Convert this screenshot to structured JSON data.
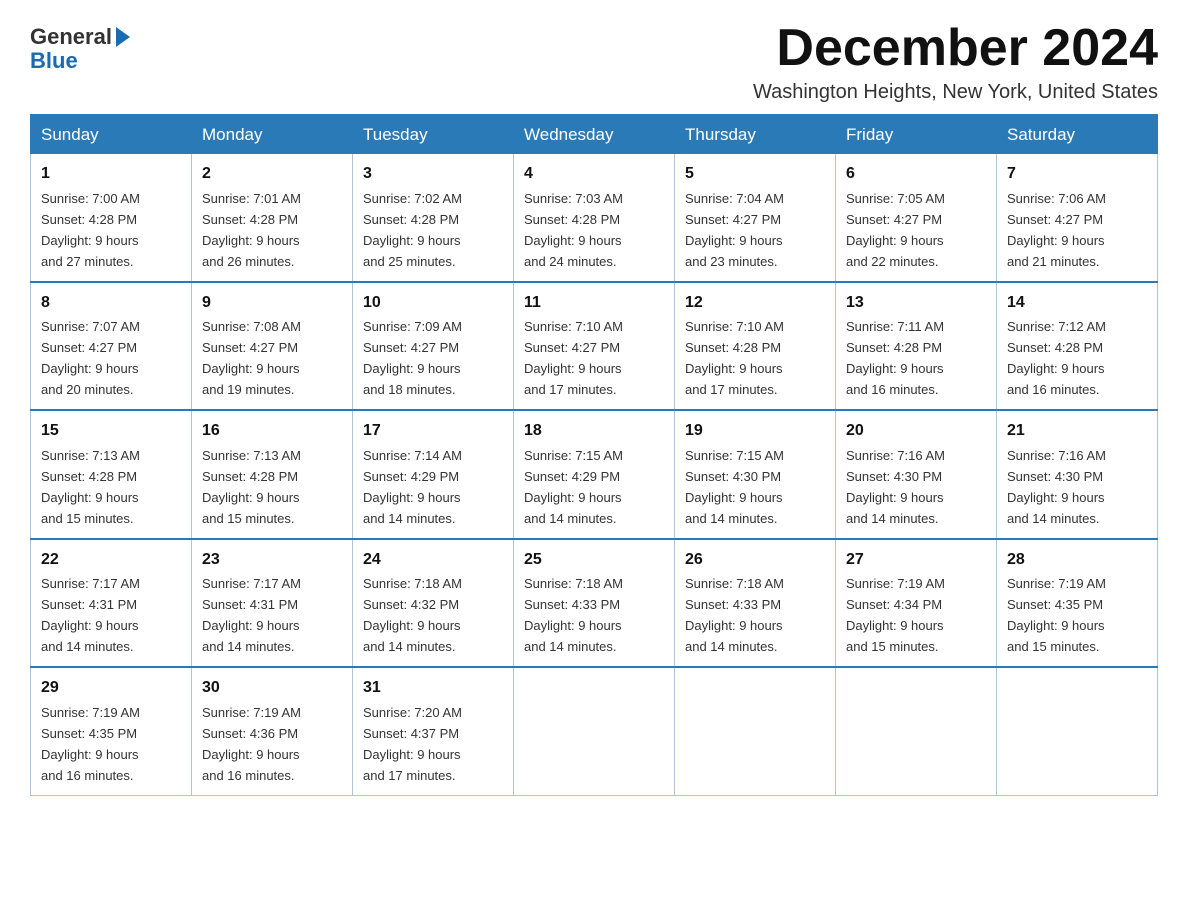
{
  "header": {
    "logo_general": "General",
    "logo_blue": "Blue",
    "month_title": "December 2024",
    "subtitle": "Washington Heights, New York, United States"
  },
  "days_of_week": [
    "Sunday",
    "Monday",
    "Tuesday",
    "Wednesday",
    "Thursday",
    "Friday",
    "Saturday"
  ],
  "weeks": [
    [
      {
        "day": "1",
        "sunrise": "7:00 AM",
        "sunset": "4:28 PM",
        "daylight": "9 hours and 27 minutes."
      },
      {
        "day": "2",
        "sunrise": "7:01 AM",
        "sunset": "4:28 PM",
        "daylight": "9 hours and 26 minutes."
      },
      {
        "day": "3",
        "sunrise": "7:02 AM",
        "sunset": "4:28 PM",
        "daylight": "9 hours and 25 minutes."
      },
      {
        "day": "4",
        "sunrise": "7:03 AM",
        "sunset": "4:28 PM",
        "daylight": "9 hours and 24 minutes."
      },
      {
        "day": "5",
        "sunrise": "7:04 AM",
        "sunset": "4:27 PM",
        "daylight": "9 hours and 23 minutes."
      },
      {
        "day": "6",
        "sunrise": "7:05 AM",
        "sunset": "4:27 PM",
        "daylight": "9 hours and 22 minutes."
      },
      {
        "day": "7",
        "sunrise": "7:06 AM",
        "sunset": "4:27 PM",
        "daylight": "9 hours and 21 minutes."
      }
    ],
    [
      {
        "day": "8",
        "sunrise": "7:07 AM",
        "sunset": "4:27 PM",
        "daylight": "9 hours and 20 minutes."
      },
      {
        "day": "9",
        "sunrise": "7:08 AM",
        "sunset": "4:27 PM",
        "daylight": "9 hours and 19 minutes."
      },
      {
        "day": "10",
        "sunrise": "7:09 AM",
        "sunset": "4:27 PM",
        "daylight": "9 hours and 18 minutes."
      },
      {
        "day": "11",
        "sunrise": "7:10 AM",
        "sunset": "4:27 PM",
        "daylight": "9 hours and 17 minutes."
      },
      {
        "day": "12",
        "sunrise": "7:10 AM",
        "sunset": "4:28 PM",
        "daylight": "9 hours and 17 minutes."
      },
      {
        "day": "13",
        "sunrise": "7:11 AM",
        "sunset": "4:28 PM",
        "daylight": "9 hours and 16 minutes."
      },
      {
        "day": "14",
        "sunrise": "7:12 AM",
        "sunset": "4:28 PM",
        "daylight": "9 hours and 16 minutes."
      }
    ],
    [
      {
        "day": "15",
        "sunrise": "7:13 AM",
        "sunset": "4:28 PM",
        "daylight": "9 hours and 15 minutes."
      },
      {
        "day": "16",
        "sunrise": "7:13 AM",
        "sunset": "4:28 PM",
        "daylight": "9 hours and 15 minutes."
      },
      {
        "day": "17",
        "sunrise": "7:14 AM",
        "sunset": "4:29 PM",
        "daylight": "9 hours and 14 minutes."
      },
      {
        "day": "18",
        "sunrise": "7:15 AM",
        "sunset": "4:29 PM",
        "daylight": "9 hours and 14 minutes."
      },
      {
        "day": "19",
        "sunrise": "7:15 AM",
        "sunset": "4:30 PM",
        "daylight": "9 hours and 14 minutes."
      },
      {
        "day": "20",
        "sunrise": "7:16 AM",
        "sunset": "4:30 PM",
        "daylight": "9 hours and 14 minutes."
      },
      {
        "day": "21",
        "sunrise": "7:16 AM",
        "sunset": "4:30 PM",
        "daylight": "9 hours and 14 minutes."
      }
    ],
    [
      {
        "day": "22",
        "sunrise": "7:17 AM",
        "sunset": "4:31 PM",
        "daylight": "9 hours and 14 minutes."
      },
      {
        "day": "23",
        "sunrise": "7:17 AM",
        "sunset": "4:31 PM",
        "daylight": "9 hours and 14 minutes."
      },
      {
        "day": "24",
        "sunrise": "7:18 AM",
        "sunset": "4:32 PM",
        "daylight": "9 hours and 14 minutes."
      },
      {
        "day": "25",
        "sunrise": "7:18 AM",
        "sunset": "4:33 PM",
        "daylight": "9 hours and 14 minutes."
      },
      {
        "day": "26",
        "sunrise": "7:18 AM",
        "sunset": "4:33 PM",
        "daylight": "9 hours and 14 minutes."
      },
      {
        "day": "27",
        "sunrise": "7:19 AM",
        "sunset": "4:34 PM",
        "daylight": "9 hours and 15 minutes."
      },
      {
        "day": "28",
        "sunrise": "7:19 AM",
        "sunset": "4:35 PM",
        "daylight": "9 hours and 15 minutes."
      }
    ],
    [
      {
        "day": "29",
        "sunrise": "7:19 AM",
        "sunset": "4:35 PM",
        "daylight": "9 hours and 16 minutes."
      },
      {
        "day": "30",
        "sunrise": "7:19 AM",
        "sunset": "4:36 PM",
        "daylight": "9 hours and 16 minutes."
      },
      {
        "day": "31",
        "sunrise": "7:20 AM",
        "sunset": "4:37 PM",
        "daylight": "9 hours and 17 minutes."
      },
      null,
      null,
      null,
      null
    ]
  ],
  "labels": {
    "sunrise": "Sunrise:",
    "sunset": "Sunset:",
    "daylight": "Daylight:"
  }
}
